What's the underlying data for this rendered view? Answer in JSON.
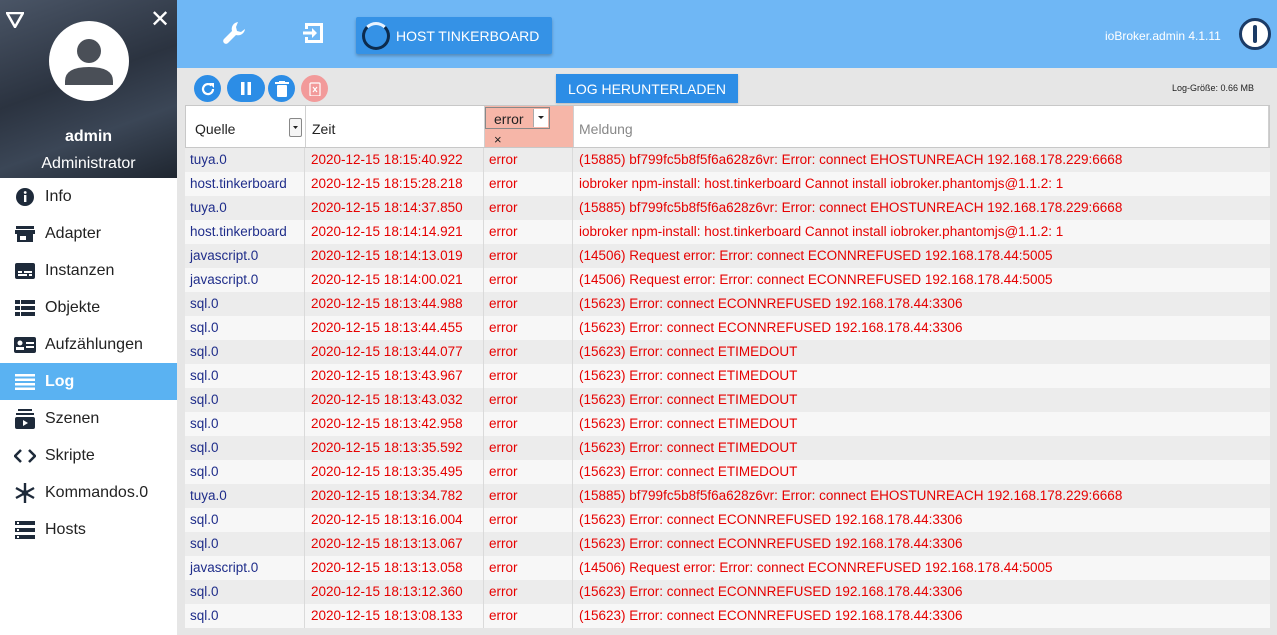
{
  "sidebar": {
    "user_name": "admin",
    "user_role": "Administrator",
    "items": [
      {
        "label": "Info",
        "icon": "info-icon"
      },
      {
        "label": "Adapter",
        "icon": "store-icon"
      },
      {
        "label": "Instanzen",
        "icon": "subtitles-icon"
      },
      {
        "label": "Objekte",
        "icon": "list-icon"
      },
      {
        "label": "Aufzählungen",
        "icon": "contact-card-icon"
      },
      {
        "label": "Log",
        "icon": "log-lines-icon",
        "active": true
      },
      {
        "label": "Szenen",
        "icon": "subscriptions-icon"
      },
      {
        "label": "Skripte",
        "icon": "code-icon"
      },
      {
        "label": "Kommandos.0",
        "icon": "snowflake-icon"
      },
      {
        "label": "Hosts",
        "icon": "storage-icon"
      }
    ]
  },
  "topbar": {
    "host_button": "HOST TINKERBOARD",
    "version": "ioBroker.admin 4.1.11"
  },
  "toolbar": {
    "download_label": "LOG HERUNTERLADEN",
    "log_size": "Log-Größe: 0.66 MB"
  },
  "table": {
    "headers": {
      "source": "Quelle",
      "time": "Zeit",
      "level_filter": "error",
      "level_clear": "×",
      "message_placeholder": "Meldung"
    },
    "rows": [
      [
        "tuya.0",
        "2020-12-15 18:15:40.922",
        "error",
        "(15885) bf799fc5b8f5f6a628z6vr: Error: connect EHOSTUNREACH 192.168.178.229:6668"
      ],
      [
        "host.tinkerboard",
        "2020-12-15 18:15:28.218",
        "error",
        "iobroker npm-install: host.tinkerboard Cannot install iobroker.phantomjs@1.1.2: 1"
      ],
      [
        "tuya.0",
        "2020-12-15 18:14:37.850",
        "error",
        "(15885) bf799fc5b8f5f6a628z6vr: Error: connect EHOSTUNREACH 192.168.178.229:6668"
      ],
      [
        "host.tinkerboard",
        "2020-12-15 18:14:14.921",
        "error",
        "iobroker npm-install: host.tinkerboard Cannot install iobroker.phantomjs@1.1.2: 1"
      ],
      [
        "javascript.0",
        "2020-12-15 18:14:13.019",
        "error",
        "(14506) Request error: Error: connect ECONNREFUSED 192.168.178.44:5005"
      ],
      [
        "javascript.0",
        "2020-12-15 18:14:00.021",
        "error",
        "(14506) Request error: Error: connect ECONNREFUSED 192.168.178.44:5005"
      ],
      [
        "sql.0",
        "2020-12-15 18:13:44.988",
        "error",
        "(15623) Error: connect ECONNREFUSED 192.168.178.44:3306"
      ],
      [
        "sql.0",
        "2020-12-15 18:13:44.455",
        "error",
        "(15623) Error: connect ECONNREFUSED 192.168.178.44:3306"
      ],
      [
        "sql.0",
        "2020-12-15 18:13:44.077",
        "error",
        "(15623) Error: connect ETIMEDOUT"
      ],
      [
        "sql.0",
        "2020-12-15 18:13:43.967",
        "error",
        "(15623) Error: connect ETIMEDOUT"
      ],
      [
        "sql.0",
        "2020-12-15 18:13:43.032",
        "error",
        "(15623) Error: connect ETIMEDOUT"
      ],
      [
        "sql.0",
        "2020-12-15 18:13:42.958",
        "error",
        "(15623) Error: connect ETIMEDOUT"
      ],
      [
        "sql.0",
        "2020-12-15 18:13:35.592",
        "error",
        "(15623) Error: connect ETIMEDOUT"
      ],
      [
        "sql.0",
        "2020-12-15 18:13:35.495",
        "error",
        "(15623) Error: connect ETIMEDOUT"
      ],
      [
        "tuya.0",
        "2020-12-15 18:13:34.782",
        "error",
        "(15885) bf799fc5b8f5f6a628z6vr: Error: connect EHOSTUNREACH 192.168.178.229:6668"
      ],
      [
        "sql.0",
        "2020-12-15 18:13:16.004",
        "error",
        "(15623) Error: connect ECONNREFUSED 192.168.178.44:3306"
      ],
      [
        "sql.0",
        "2020-12-15 18:13:13.067",
        "error",
        "(15623) Error: connect ECONNREFUSED 192.168.178.44:3306"
      ],
      [
        "javascript.0",
        "2020-12-15 18:13:13.058",
        "error",
        "(14506) Request error: Error: connect ECONNREFUSED 192.168.178.44:5005"
      ],
      [
        "sql.0",
        "2020-12-15 18:13:12.360",
        "error",
        "(15623) Error: connect ECONNREFUSED 192.168.178.44:3306"
      ],
      [
        "sql.0",
        "2020-12-15 18:13:08.133",
        "error",
        "(15623) Error: connect ECONNREFUSED 192.168.178.44:3306"
      ]
    ]
  },
  "colors": {
    "accent": "#3592e6",
    "topbar": "#6fb7f5",
    "error_text": "#e60000",
    "source_text": "#1f2d8a"
  }
}
